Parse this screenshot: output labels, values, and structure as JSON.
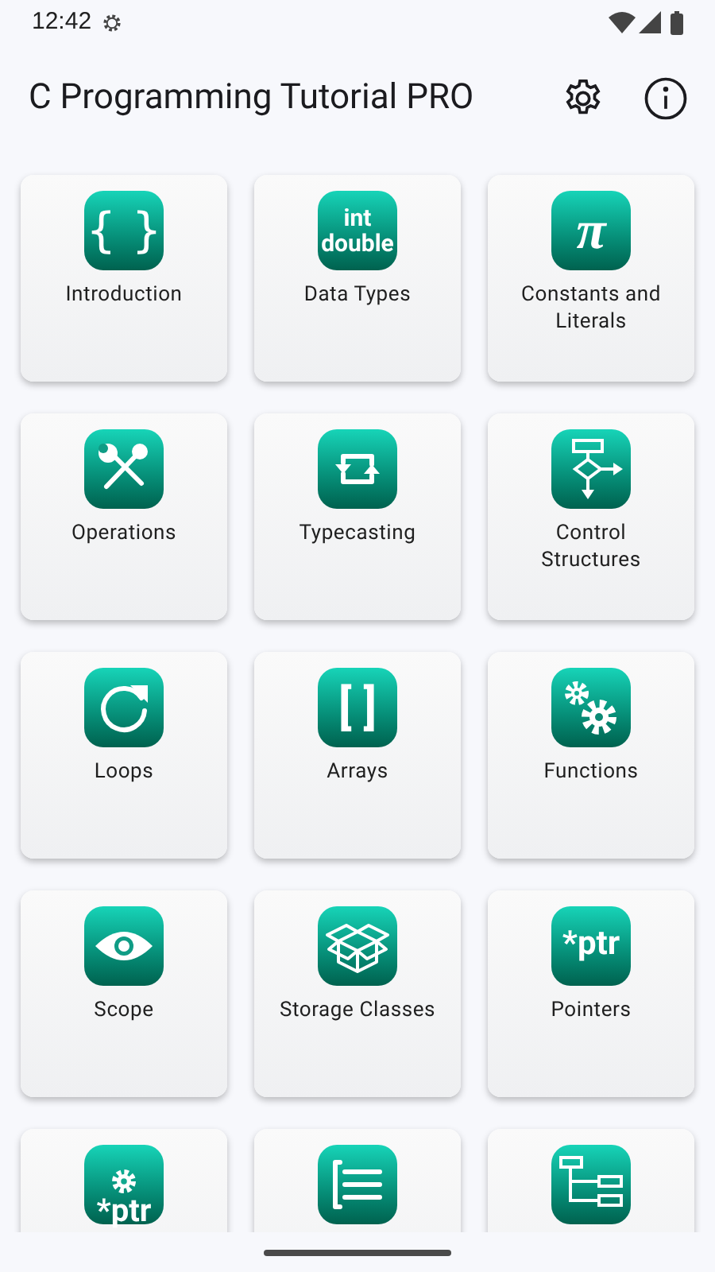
{
  "status_bar": {
    "time": "12:42"
  },
  "app_bar": {
    "title": "C Programming Tutorial PRO"
  },
  "topics": [
    {
      "label": "Introduction",
      "kind": "braces",
      "icon_text": "{ }"
    },
    {
      "label": "Data Types",
      "kind": "types",
      "icon_text": "int double"
    },
    {
      "label": "Constants and Literals",
      "kind": "pi",
      "icon_text": "π"
    },
    {
      "label": "Operations",
      "kind": "tools"
    },
    {
      "label": "Typecasting",
      "kind": "cycle"
    },
    {
      "label": "Control Structures",
      "kind": "flowchart"
    },
    {
      "label": "Loops",
      "kind": "reload"
    },
    {
      "label": "Arrays",
      "kind": "brackets",
      "icon_text": "[ ]"
    },
    {
      "label": "Functions",
      "kind": "gears"
    },
    {
      "label": "Scope",
      "kind": "eye"
    },
    {
      "label": "Storage Classes",
      "kind": "box"
    },
    {
      "label": "Pointers",
      "kind": "ptr",
      "icon_text": "*ptr"
    },
    {
      "kind": "gearptr",
      "icon_text": "*ptr"
    },
    {
      "kind": "list"
    },
    {
      "kind": "tree"
    }
  ]
}
